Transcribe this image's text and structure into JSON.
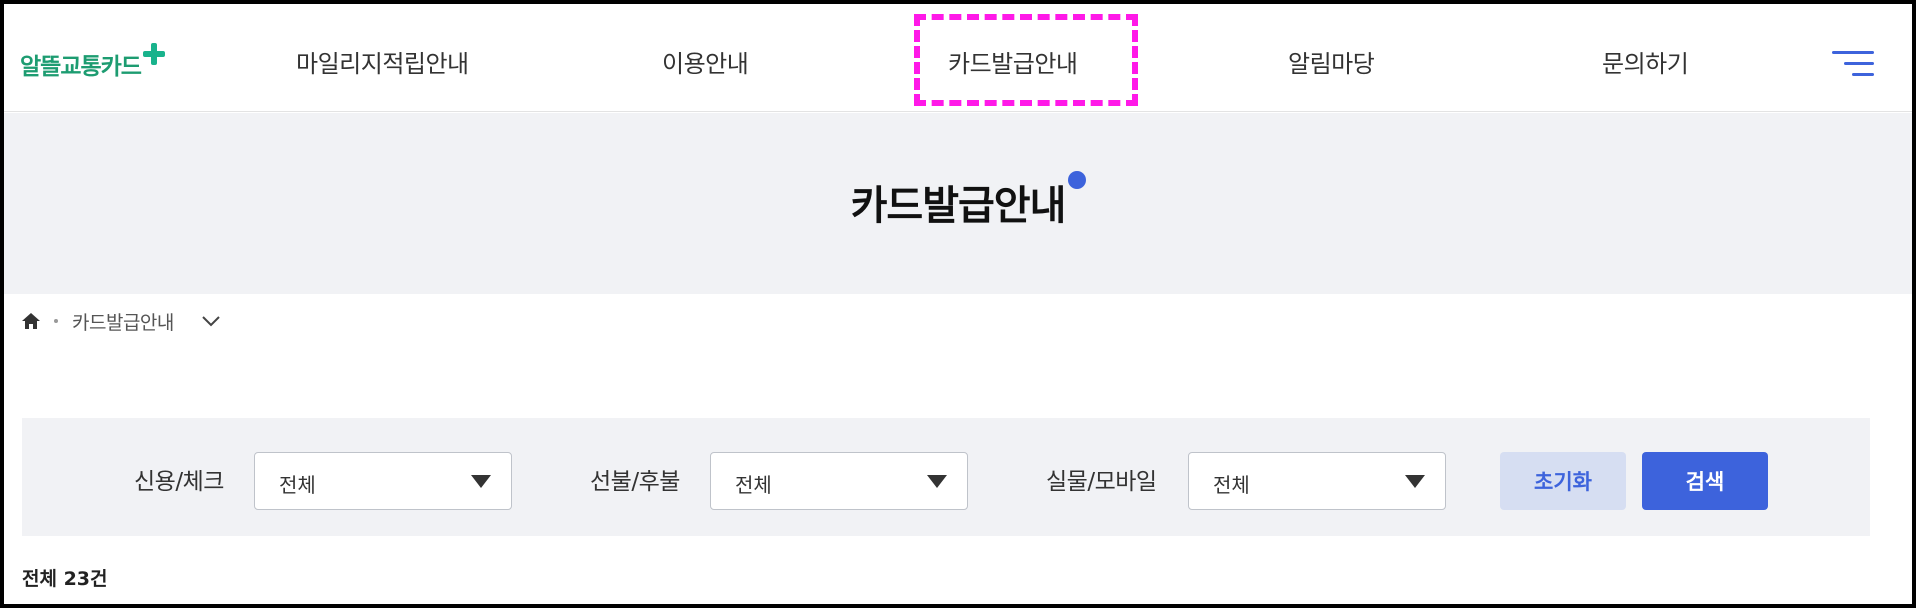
{
  "header": {
    "logo_text": "알뜰교통카드",
    "nav": [
      "마일리지적립안내",
      "이용안내",
      "카드발급안내",
      "알림마당",
      "문의하기"
    ]
  },
  "banner": {
    "title": "카드발급안내"
  },
  "breadcrumb": {
    "current": "카드발급안내"
  },
  "filters": [
    {
      "label": "신용/체크",
      "value": "전체"
    },
    {
      "label": "선불/후불",
      "value": "전체"
    },
    {
      "label": "실물/모바일",
      "value": "전체"
    }
  ],
  "buttons": {
    "reset": "초기화",
    "search": "검색"
  },
  "results": {
    "total": "전체 23건"
  },
  "colors": {
    "accent": "#3d63dc",
    "brand_green": "#1d9c71",
    "highlight": "#ff19e8",
    "banner_bg": "#f1f2f5"
  },
  "icons": [
    "home-icon",
    "chevron-down-icon",
    "hamburger-menu-icon",
    "dropdown-arrow-icon"
  ]
}
